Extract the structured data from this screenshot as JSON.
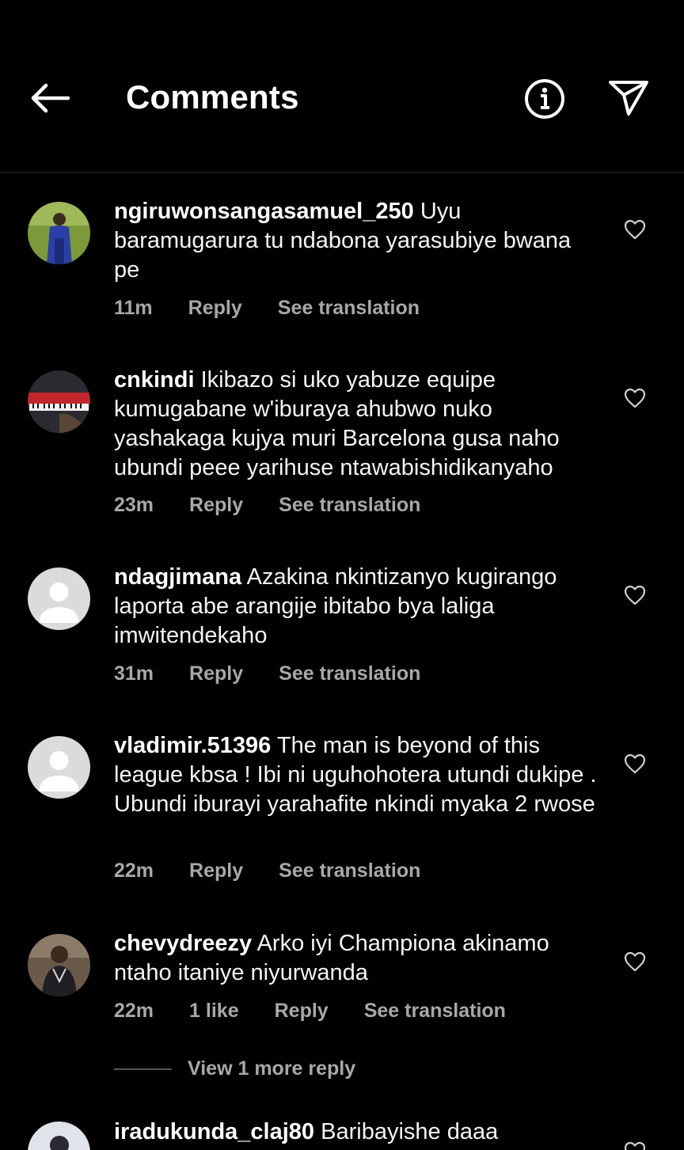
{
  "header": {
    "title": "Comments",
    "back_icon": "arrow-left-icon",
    "info_icon": "info-icon",
    "share_icon": "paper-plane-icon"
  },
  "comments": [
    {
      "username": "ngiruwonsangasamuel_250",
      "text": "Uyu baramugarura tu ndabona yarasubiye bwana pe",
      "time": "11m",
      "reply": "Reply",
      "translate": "See translation",
      "avatar": "photo"
    },
    {
      "username": "cnkindi",
      "text": "Ikibazo si uko yabuze equipe kumugabane w'iburaya ahubwo nuko yashakaga kujya muri Barcelona gusa naho ubundi peee yarihuse ntawabishidikanyaho",
      "time": "23m",
      "reply": "Reply",
      "translate": "See translation",
      "avatar": "photo"
    },
    {
      "username": "ndagjimana",
      "text": "Azakina nkintizanyo kugirango laporta abe arangije ibitabo bya laliga imwitendekaho",
      "time": "31m",
      "reply": "Reply",
      "translate": "See translation",
      "avatar": "default"
    },
    {
      "username": "vladimir.51396",
      "text": "The man is beyond of this league kbsa ! Ibi ni uguhohotera utundi dukipe . Ubundi iburayi yarahafite nkindi myaka 2 rwose",
      "time": "22m",
      "reply": "Reply",
      "translate": "See translation",
      "avatar": "default"
    },
    {
      "username": "chevydreezy",
      "text": "Arko iyi Championa akinamo ntaho itaniye niyurwanda",
      "time": "22m",
      "likes": "1 like",
      "reply": "Reply",
      "translate": "See translation",
      "avatar": "photo"
    },
    {
      "username": "iradukunda_claj80",
      "text": "Baribayishe daaa",
      "avatar": "photo"
    }
  ],
  "view_more_replies": "View 1 more reply",
  "colors": {
    "background": "#000000",
    "text": "#f5f5f5",
    "secondary": "#a8a8a8",
    "divider": "#262626"
  }
}
